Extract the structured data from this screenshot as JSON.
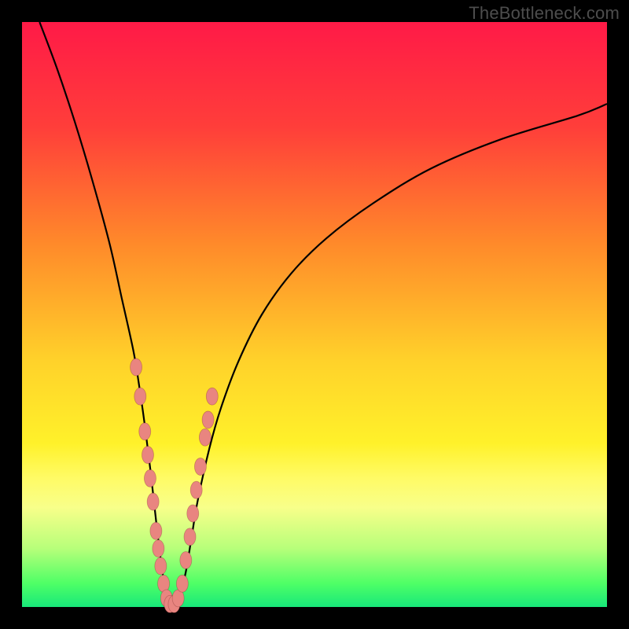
{
  "watermark": {
    "text": "TheBottleneck.com"
  },
  "colors": {
    "frame": "#000000",
    "gradient_stops": [
      {
        "pct": 0,
        "color": "#ff1a47"
      },
      {
        "pct": 18,
        "color": "#ff3e3a"
      },
      {
        "pct": 38,
        "color": "#ff8a2a"
      },
      {
        "pct": 58,
        "color": "#ffd22a"
      },
      {
        "pct": 72,
        "color": "#fff12a"
      },
      {
        "pct": 78,
        "color": "#fffb66"
      },
      {
        "pct": 83,
        "color": "#f8ff8a"
      },
      {
        "pct": 90,
        "color": "#b7ff7a"
      },
      {
        "pct": 96,
        "color": "#4eff66"
      },
      {
        "pct": 100,
        "color": "#18e87a"
      }
    ],
    "curve": "#000000",
    "marker_fill": "#e98580"
  },
  "chart_data": {
    "type": "line",
    "title": "",
    "xlabel": "",
    "ylabel": "",
    "xlim": [
      0,
      100
    ],
    "ylim": [
      0,
      100
    ],
    "note": "Conceptual bottleneck curve: y is estimated bottleneck percentage (0 = no bottleneck at the green band, 100 = severe at top red). x is an unlabeled hardware-balance axis. The sharp V-shaped minimum sits near x ≈ 25; values rise steeply to the left and more gradually to the right. Values are read off the gradient position, not explicit tick labels.",
    "series": [
      {
        "name": "bottleneck-curve",
        "x": [
          3,
          6,
          9,
          12,
          15,
          17,
          19,
          20,
          21,
          22,
          23,
          24,
          25,
          26,
          27,
          28,
          29,
          30,
          32,
          34,
          37,
          41,
          46,
          52,
          60,
          70,
          82,
          95,
          100
        ],
        "y": [
          100,
          92,
          83,
          73,
          62,
          53,
          44,
          38,
          31,
          23,
          14,
          6,
          0,
          0,
          2,
          6,
          12,
          18,
          27,
          34,
          42,
          50,
          57,
          63,
          69,
          75,
          80,
          84,
          86
        ]
      }
    ],
    "markers": {
      "name": "highlighted-points",
      "comment": "Pink capsule-style markers clustered around the minimum on both arms of the V.",
      "points": [
        {
          "x": 19.5,
          "y": 41
        },
        {
          "x": 20.2,
          "y": 36
        },
        {
          "x": 21.0,
          "y": 30
        },
        {
          "x": 21.5,
          "y": 26
        },
        {
          "x": 21.9,
          "y": 22
        },
        {
          "x": 22.4,
          "y": 18
        },
        {
          "x": 22.9,
          "y": 13
        },
        {
          "x": 23.3,
          "y": 10
        },
        {
          "x": 23.7,
          "y": 7
        },
        {
          "x": 24.2,
          "y": 4
        },
        {
          "x": 24.7,
          "y": 1.5
        },
        {
          "x": 25.3,
          "y": 0.5
        },
        {
          "x": 26.0,
          "y": 0.5
        },
        {
          "x": 26.7,
          "y": 1.5
        },
        {
          "x": 27.4,
          "y": 4
        },
        {
          "x": 28.0,
          "y": 8
        },
        {
          "x": 28.7,
          "y": 12
        },
        {
          "x": 29.2,
          "y": 16
        },
        {
          "x": 29.8,
          "y": 20
        },
        {
          "x": 30.5,
          "y": 24
        },
        {
          "x": 31.3,
          "y": 29
        },
        {
          "x": 31.8,
          "y": 32
        },
        {
          "x": 32.5,
          "y": 36
        }
      ]
    }
  }
}
